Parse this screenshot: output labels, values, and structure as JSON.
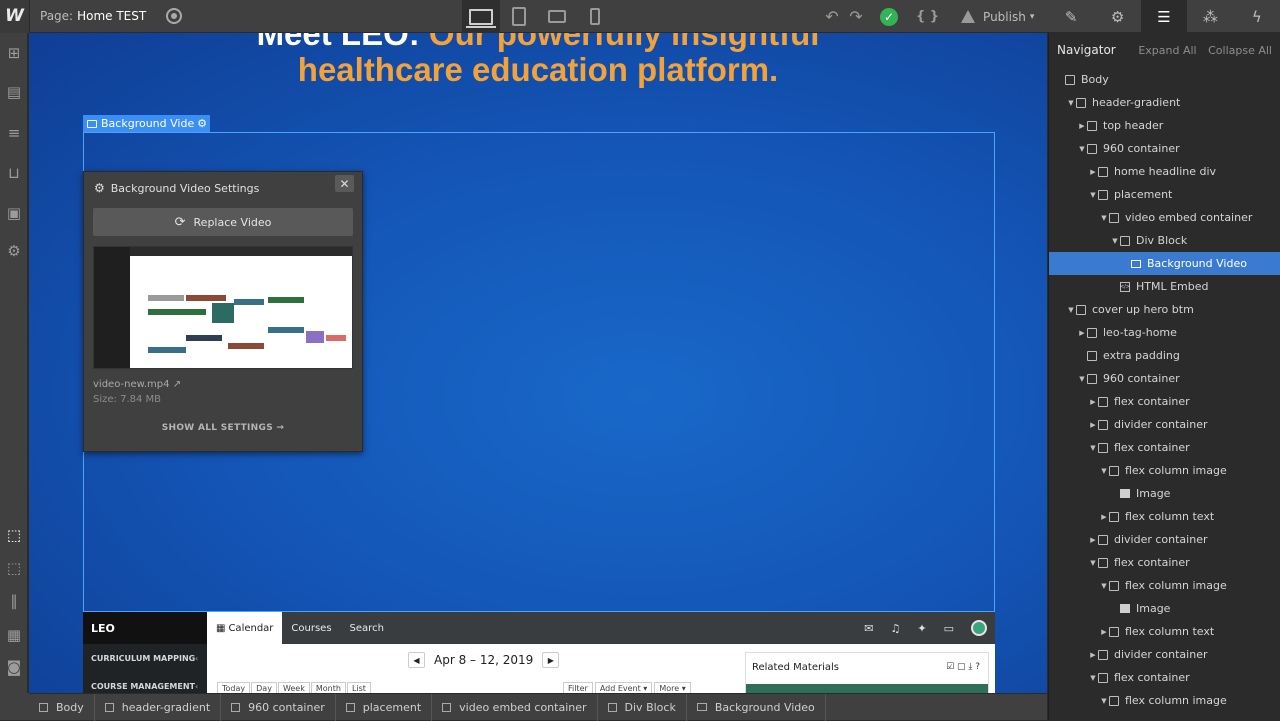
{
  "topbar": {
    "logo": "W",
    "page_label": "Page:",
    "page_name": "Home TEST",
    "publish_label": "Publish",
    "code_label": "{ }"
  },
  "canvas": {
    "hero_line1_white": "Meet LEO:",
    "hero_line1_orange": " Our powerfully insightful",
    "hero_line2": "healthcare education platform.",
    "selected_label": "Background Video"
  },
  "settings_panel": {
    "title": "Background Video Settings",
    "replace_label": "Replace Video",
    "file_name": "video-new.mp4",
    "file_size": "Size: 7.84 MB",
    "show_all": "SHOW ALL SETTINGS →"
  },
  "app_preview": {
    "logo": "LEO",
    "tabs": [
      "Calendar",
      "Courses",
      "Search"
    ],
    "side_items": [
      "CURRICULUM MAPPING",
      "COURSE MANAGEMENT"
    ],
    "date_range": "Apr 8 – 12, 2019",
    "view_buttons": [
      "Today",
      "Day",
      "Week",
      "Month",
      "List"
    ],
    "filter_buttons": [
      "Filter",
      "Add Event ▾",
      "More ▾"
    ],
    "related_title": "Related Materials"
  },
  "navigator": {
    "title": "Navigator",
    "expand_all": "Expand All",
    "collapse_all": "Collapse All",
    "rows": [
      {
        "label": "Body",
        "depth": 0,
        "caret": "",
        "icon": "box"
      },
      {
        "label": "header-gradient",
        "depth": 1,
        "caret": "open",
        "icon": "box"
      },
      {
        "label": "top header",
        "depth": 2,
        "caret": "closed",
        "icon": "box"
      },
      {
        "label": "960 container",
        "depth": 2,
        "caret": "open",
        "icon": "box"
      },
      {
        "label": "home headline div",
        "depth": 3,
        "caret": "closed",
        "icon": "box"
      },
      {
        "label": "placement",
        "depth": 3,
        "caret": "open",
        "icon": "box"
      },
      {
        "label": "video embed container",
        "depth": 4,
        "caret": "open",
        "icon": "box"
      },
      {
        "label": "Div Block",
        "depth": 5,
        "caret": "open",
        "icon": "box"
      },
      {
        "label": "Background Video",
        "depth": 6,
        "caret": "",
        "icon": "video",
        "selected": true
      },
      {
        "label": "HTML Embed",
        "depth": 5,
        "caret": "",
        "icon": "embed"
      },
      {
        "label": "cover up hero btm",
        "depth": 1,
        "caret": "open",
        "icon": "box"
      },
      {
        "label": "leo-tag-home",
        "depth": 2,
        "caret": "closed",
        "icon": "box"
      },
      {
        "label": "extra padding",
        "depth": 2,
        "caret": "",
        "icon": "box"
      },
      {
        "label": "960 container",
        "depth": 2,
        "caret": "open",
        "icon": "box"
      },
      {
        "label": "flex container",
        "depth": 3,
        "caret": "closed",
        "icon": "box"
      },
      {
        "label": "divider container",
        "depth": 3,
        "caret": "closed",
        "icon": "box"
      },
      {
        "label": "flex container",
        "depth": 3,
        "caret": "open",
        "icon": "box"
      },
      {
        "label": "flex column image",
        "depth": 4,
        "caret": "open",
        "icon": "box"
      },
      {
        "label": "Image",
        "depth": 5,
        "caret": "",
        "icon": "image"
      },
      {
        "label": "flex column text",
        "depth": 4,
        "caret": "closed",
        "icon": "box"
      },
      {
        "label": "divider container",
        "depth": 3,
        "caret": "closed",
        "icon": "box"
      },
      {
        "label": "flex container",
        "depth": 3,
        "caret": "open",
        "icon": "box"
      },
      {
        "label": "flex column image",
        "depth": 4,
        "caret": "open",
        "icon": "box"
      },
      {
        "label": "Image",
        "depth": 5,
        "caret": "",
        "icon": "image"
      },
      {
        "label": "flex column text",
        "depth": 4,
        "caret": "closed",
        "icon": "box"
      },
      {
        "label": "divider container",
        "depth": 3,
        "caret": "closed",
        "icon": "box"
      },
      {
        "label": "flex container",
        "depth": 3,
        "caret": "open",
        "icon": "box"
      },
      {
        "label": "flex column image",
        "depth": 4,
        "caret": "open",
        "icon": "box"
      }
    ]
  },
  "breadcrumbs": [
    "Body",
    "header-gradient",
    "960 container",
    "placement",
    "video embed container",
    "Div Block",
    "Background Video"
  ],
  "colors": {
    "accent": "#3b8ef3",
    "hero_orange": "#f2a23a",
    "status_ok": "#32b356"
  }
}
